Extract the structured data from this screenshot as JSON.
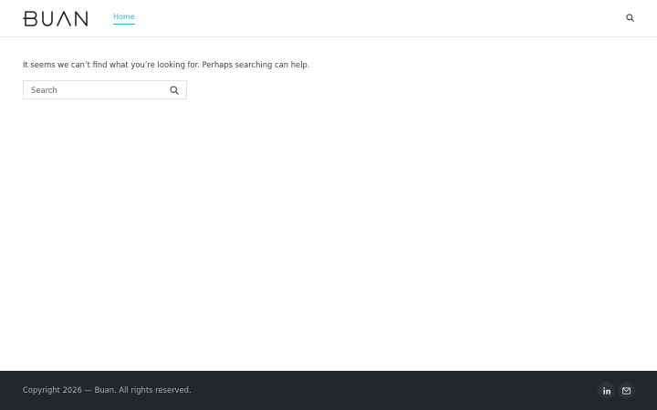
{
  "header": {
    "logo_text": "BUAN",
    "nav": [
      {
        "label": "Home",
        "active": true
      }
    ],
    "search_icon": "search-icon"
  },
  "main": {
    "message": "It seems we can’t find what you’re looking for. Perhaps searching can help.",
    "search": {
      "placeholder": "Search",
      "value": "",
      "submit_icon": "search-icon"
    }
  },
  "footer": {
    "copyright": "Copyright 2026 — Buan. All rights reserved.",
    "social": [
      {
        "name": "linkedin-icon"
      },
      {
        "name": "email-icon"
      }
    ]
  },
  "colors": {
    "accent": "#3eb0c2",
    "text": "#3a3f45",
    "footer_bg": "#22262b",
    "footer_text": "#a9b0b8",
    "border": "#e9ecef"
  }
}
